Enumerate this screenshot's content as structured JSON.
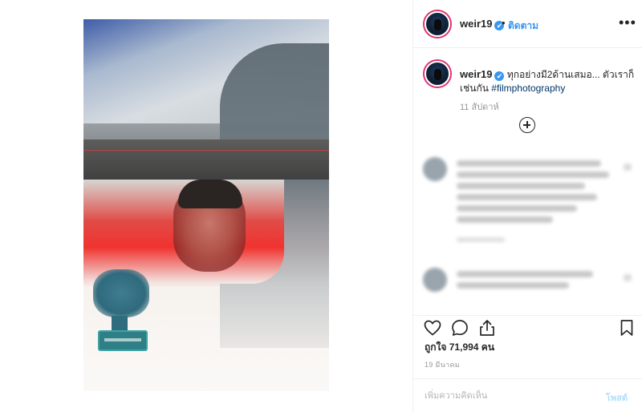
{
  "post": {
    "username": "weir19",
    "verified_mark": "✔",
    "separator": "•",
    "follow_label": "ติดตาม",
    "more_label": "•••",
    "caption_text": "ทุกอย่างมี2ด้านเสมอ... ตัวเราก็เช่นกัน",
    "caption_hashtag": "#filmphotography",
    "caption_time": "11 สัปดาห์",
    "likes_text": "ถูกใจ 71,994 คน",
    "date_text": "19 มีนาคม",
    "comment_placeholder": "เพิ่มความคิดเห็น",
    "post_label": "โพสต์"
  },
  "icons": {
    "like": "heart-icon",
    "comment": "comment-icon",
    "share": "share-icon",
    "save": "bookmark-icon",
    "load_more": "plus-circle-icon",
    "more": "more-dots-icon"
  },
  "colors": {
    "link_blue": "#3897f0",
    "hashtag": "#003569",
    "muted": "#999999",
    "post_disabled": "#b2dffc"
  }
}
